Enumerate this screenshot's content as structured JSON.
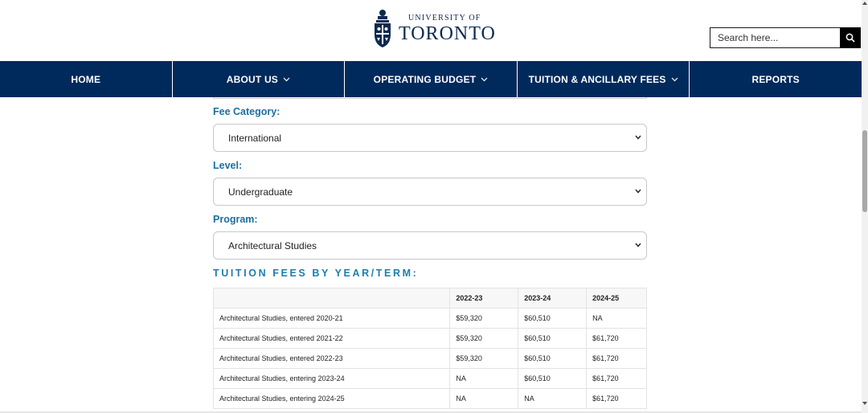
{
  "header": {
    "logo_small": "UNIVERSITY OF",
    "logo_big": "TORONTO",
    "search_placeholder": "Search here..."
  },
  "nav": {
    "items": [
      {
        "label": "HOME",
        "dropdown": false
      },
      {
        "label": "ABOUT US",
        "dropdown": true
      },
      {
        "label": "OPERATING BUDGET",
        "dropdown": true
      },
      {
        "label": "TUITION & ANCILLARY FEES",
        "dropdown": true
      },
      {
        "label": "REPORTS",
        "dropdown": false
      }
    ]
  },
  "form": {
    "fee_category_label": "Fee Category:",
    "fee_category_value": "International",
    "level_label": "Level:",
    "level_value": "Undergraduate",
    "program_label": "Program:",
    "program_value": "Architectural Studies"
  },
  "fees_table": {
    "title": "TUITION FEES BY YEAR/TERM:",
    "headers": [
      "",
      "2022-23",
      "2023-24",
      "2024-25"
    ],
    "rows": [
      [
        "Architectural Studies, entered 2020-21",
        "$59,320",
        "$60,510",
        "NA"
      ],
      [
        "Architectural Studies, entered 2021-22",
        "$59,320",
        "$60,510",
        "$61,720"
      ],
      [
        "Architectural Studies, entered 2022-23",
        "$59,320",
        "$60,510",
        "$61,720"
      ],
      [
        "Architectural Studies, entering 2023-24",
        "NA",
        "$60,510",
        "$61,720"
      ],
      [
        "Architectural Studies, entering 2024-25",
        "NA",
        "NA",
        "$61,720"
      ]
    ]
  },
  "colors": {
    "nav_bg": "#002a5c",
    "label_blue": "#1a6fa0",
    "brand_navy": "#0b2a52"
  },
  "icons": {
    "search": "search-icon",
    "chevron": "chevron-down-icon",
    "crest": "crest-icon"
  }
}
